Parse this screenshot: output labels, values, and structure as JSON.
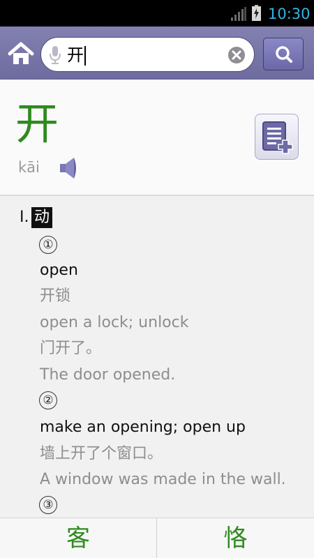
{
  "status_bar": {
    "time": "10:30"
  },
  "search": {
    "query": "开"
  },
  "entry": {
    "headword": "开",
    "pinyin": "kāi"
  },
  "definitions": {
    "pos_number": "I.",
    "pos_tag": "动",
    "senses": [
      {
        "number": "①",
        "gloss": "open",
        "examples": [
          [
            "开锁",
            "open a lock; unlock"
          ],
          [
            "门开了。",
            "The door opened."
          ]
        ]
      },
      {
        "number": "②",
        "gloss": "make an opening; open up",
        "examples": [
          [
            "墙上开了个窗口。",
            "A window was made in the wall."
          ]
        ]
      },
      {
        "number": "③"
      }
    ]
  },
  "bottom_nav": {
    "prev_word": "客",
    "next_word": "恪"
  },
  "colors": {
    "accent_green": "#2e8b1e",
    "header_purple": "#7a78aa",
    "status_blue": "#33b5e5"
  },
  "icons": [
    "signal-icon",
    "battery-charging-icon",
    "home-icon",
    "mic-icon",
    "clear-icon",
    "search-icon",
    "speaker-icon",
    "add-to-wordbook-icon"
  ]
}
